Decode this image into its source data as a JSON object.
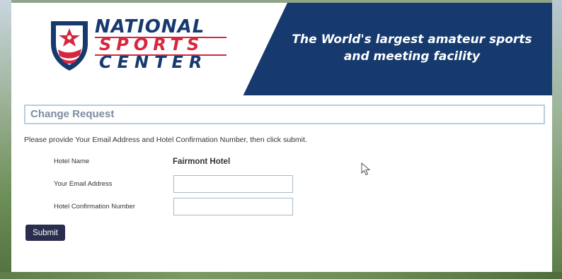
{
  "header": {
    "logo": {
      "line1": "NATIONAL",
      "line2": "SPORTS",
      "line3": "CENTER"
    },
    "tagline": "The World's largest amateur sports and meeting facility"
  },
  "form": {
    "section_title": "Change Request",
    "instructions": "Please provide Your Email Address and Hotel Confirmation Number, then click submit.",
    "hotel_name_label": "Hotel Name",
    "hotel_name_value": "Fairmont Hotel",
    "email_label": "Your Email Address",
    "email_value": "",
    "confirmation_label": "Hotel Confirmation Number",
    "confirmation_value": "",
    "submit_label": "Submit"
  },
  "icons": {
    "logo": "shield-star-logo-icon",
    "cursor": "mouse-pointer-icon"
  },
  "colors": {
    "header_navy": "#163a6d",
    "brand_red": "#d7263d",
    "button": "#2b2d4f",
    "section_border": "#b9cde0",
    "section_text": "#7d8da0"
  }
}
